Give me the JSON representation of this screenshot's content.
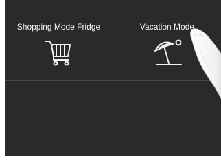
{
  "tiles": {
    "shopping": {
      "label": "Shopping Mode Fridge",
      "icon": "shopping-cart-icon"
    },
    "vacation": {
      "label": "Vacation Mode",
      "icon": "beach-umbrella-icon"
    }
  },
  "colors": {
    "background": "#2a2a2a",
    "text": "#f2f2f2",
    "divider": "#4a4a4a"
  }
}
